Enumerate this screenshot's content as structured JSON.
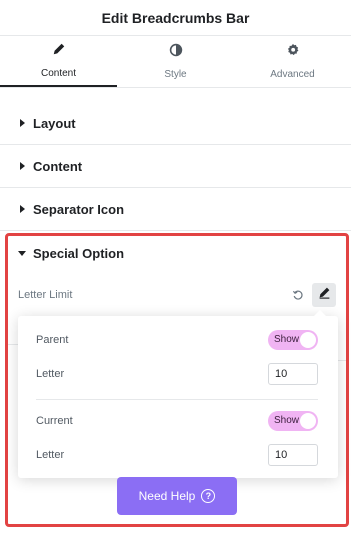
{
  "header": {
    "title": "Edit Breadcrumbs Bar"
  },
  "tabs": [
    {
      "label": "Content",
      "icon": "pencil-icon",
      "active": true
    },
    {
      "label": "Style",
      "icon": "half-circle-icon",
      "active": false
    },
    {
      "label": "Advanced",
      "icon": "gear-icon",
      "active": false
    }
  ],
  "sections": [
    {
      "label": "Layout"
    },
    {
      "label": "Content"
    },
    {
      "label": "Separator Icon"
    }
  ],
  "special_option": {
    "label": "Special Option",
    "letter_limit_label": "Letter Limit",
    "popover": {
      "parent_label": "Parent",
      "parent_toggle": "Show",
      "parent_letter_label": "Letter",
      "parent_letter_value": "10",
      "current_label": "Current",
      "current_toggle": "Show",
      "current_letter_label": "Letter",
      "current_letter_value": "10"
    }
  },
  "help_button": {
    "label": "Need Help",
    "icon": "question-circle-icon"
  },
  "colors": {
    "highlight": "#e24343",
    "toggle_bg": "#f0b4f3",
    "help_button_bg": "#8b6ef4"
  }
}
